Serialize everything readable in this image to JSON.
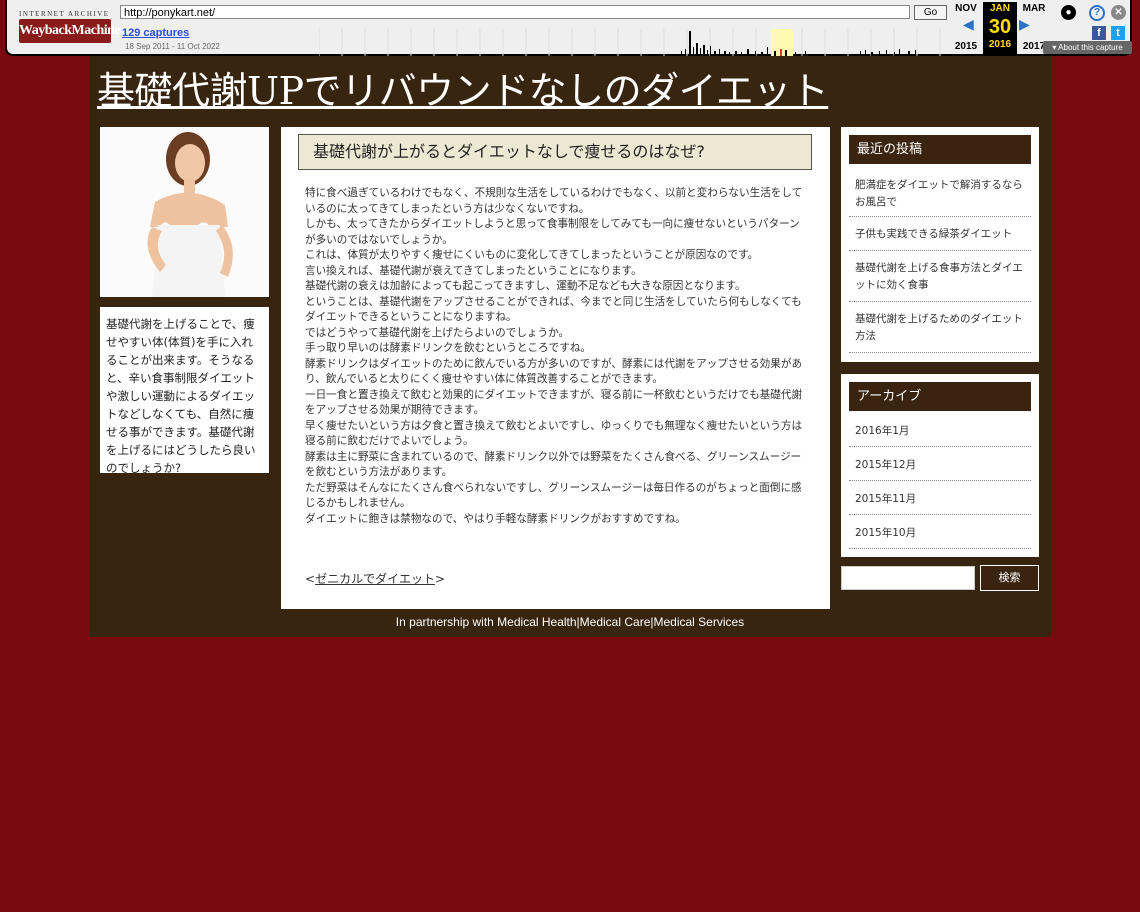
{
  "wayback": {
    "ia_label": "INTERNET ARCHIVE",
    "logo": "WaybackMachine",
    "url": "http://ponykart.net/",
    "go_label": "Go",
    "captures": "129 captures",
    "date_range": "18 Sep 2011 - 11 Oct 2022",
    "prev_month": "NOV",
    "cur_month": "JAN",
    "next_month": "MAR",
    "cur_day": "30",
    "prev_year": "2015",
    "cur_year": "2016",
    "next_year": "2017",
    "about": "About this capture",
    "icons": [
      "user-icon",
      "help-icon",
      "close-icon",
      "facebook-icon",
      "twitter-icon"
    ]
  },
  "site": {
    "title": "基礎代謝UPでリバウンドなしのダイエット"
  },
  "intro_text": "基礎代謝を上げることで、痩せやすい体(体質)を手に入れることが出来ます。そうなると、辛い食事制限ダイエットや激しい運動によるダイエットなどしなくても、自然に痩せる事ができます。基礎代謝を上げるにはどうしたら良いのでしょうか?",
  "article": {
    "heading": "基礎代謝が上がるとダイエットなしで痩せるのはなぜ?",
    "paragraphs": [
      "特に食べ過ぎているわけでもなく、不規則な生活をしているわけでもなく、以前と変わらない生活をしているのに太ってきてしまったという方は少なくないですね。",
      "しかも、太ってきたからダイエットしようと思って食事制限をしてみても一向に痩せないというパターンが多いのではないでしょうか。",
      "これは、体質が太りやすく痩せにくいものに変化してきてしまったということが原因なのです。",
      "言い換えれば、基礎代謝が衰えてきてしまったということになります。",
      "基礎代謝の衰えは加齢によっても起こってきますし、運動不足なども大きな原因となります。",
      "ということは、基礎代謝をアップさせることができれば、今までと同じ生活をしていたら何もしなくてもダイエットできるということになりますね。",
      "ではどうやって基礎代謝を上げたらよいのでしょうか。",
      "手っ取り早いのは酵素ドリンクを飲むというところですね。",
      "酵素ドリンクはダイエットのために飲んでいる方が多いのですが、酵素には代謝をアップさせる効果があり、飲んでいると太りにくく痩せやすい体に体質改善することができます。",
      "一日一食と置き換えて飲むと効果的にダイエットできますが、寝る前に一杯飲むというだけでも基礎代謝をアップさせる効果が期待できます。",
      "早く痩せたいという方は夕食と置き換えて飲むとよいですし、ゆっくりでも無理なく痩せたいという方は寝る前に飲むだけでよいでしょう。",
      "酵素は主に野菜に含まれているので、酵素ドリンク以外では野菜をたくさん食べる、グリーンスムージーを飲むという方法があります。",
      "ただ野菜はそんなにたくさん食べられないですし、グリーンスムージーは毎日作るのがちょっと面倒に感じるかもしれません。",
      "ダイエットに飽きは禁物なので、やはり手軽な酵素ドリンクがおすすめですね。"
    ],
    "link_open": "<",
    "link_text": "ゼニカルでダイエット",
    "link_close": ">"
  },
  "recent": {
    "heading": "最近の投稿",
    "items": [
      "肥満症をダイエットで解消するならお風呂で",
      "子供も実践できる緑茶ダイエット",
      "基礎代謝を上げる食事方法とダイエットに効く食事",
      "基礎代謝を上げるためのダイエット方法"
    ]
  },
  "archive": {
    "heading": "アーカイブ",
    "items": [
      "2016年1月",
      "2015年12月",
      "2015年11月",
      "2015年10月"
    ]
  },
  "search": {
    "button": "検索"
  },
  "footer": "In partnership with Medical Health|Medical Care|Medical Services"
}
